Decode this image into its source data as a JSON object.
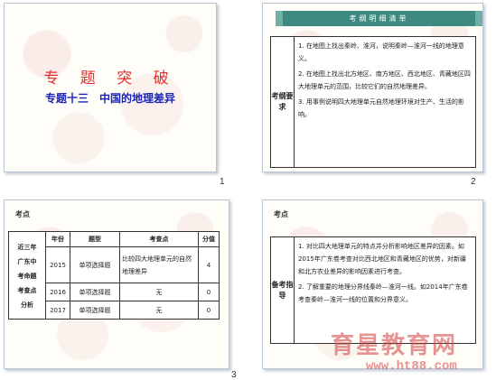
{
  "slides": [
    {
      "number": "1",
      "title": "专 题 突 破",
      "subtitle": "专题十三　中国的地理差异"
    },
    {
      "number": "2",
      "banner": "考纲明细清单",
      "label": "考纲要求",
      "items": [
        "1. 在地图上找出秦岭、淮河，说明秦岭—淮河一线的地理意义。",
        "2. 在地图上找出北方地区、南方地区、西北地区、青藏地区四大地理单元的范围，比较它们的自然地理差异。",
        "3. 用事例说明四大地理单元自然地理环境对生产、生活的影响。"
      ]
    },
    {
      "number": "3",
      "label": "考点",
      "table": {
        "headers": [
          "近三年广东中考命题考查点分析",
          "年份",
          "题型",
          "考查点",
          "分值"
        ],
        "row_header": "近三年广东中考命题考查点分析",
        "rows": [
          {
            "year": "2015",
            "type": "单项选择题",
            "point": "比较四大地理单元的自然地理差异",
            "score": "4"
          },
          {
            "year": "2016",
            "type": "单项选择题",
            "point": "无",
            "score": "0"
          },
          {
            "year": "2017",
            "type": "单项选择题",
            "point": "无",
            "score": "0"
          }
        ]
      }
    },
    {
      "number": "4",
      "label": "考点",
      "box_label": "备考指导",
      "items": [
        "1. 对比四大地理单元的特点并分析影响地区差异的因素。如2015年广东卷考查对比西北地区和青藏地区的优势，对新疆和北方农业差异的影响因素进行考查。",
        "2. 了解重要的地理分界线秦岭—淮河一线。如2014年广东卷考查秦岭—淮河一线的位置和分界意义。"
      ]
    }
  ],
  "watermark": {
    "text": "育星教育网",
    "url": "www.ht88.com"
  }
}
